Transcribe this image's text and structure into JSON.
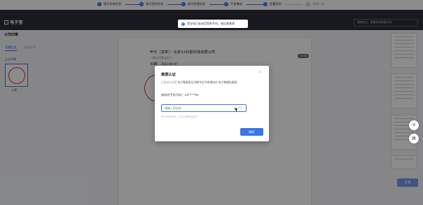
{
  "steps": [
    {
      "label": "填写机构信息",
      "state": "done"
    },
    {
      "label": "填写资质信息",
      "state": "done"
    },
    {
      "label": "填写经营信息",
      "state": "done"
    },
    {
      "label": "平台审核",
      "state": "done"
    },
    {
      "label": "签署合同",
      "state": "done"
    },
    {
      "label": "领域入驻",
      "state": "pending",
      "number": "6"
    }
  ],
  "header": {
    "logo": "电子签",
    "right_text": "我的企业：某某科技有限公司"
  },
  "toast": {
    "text": "验证码已发送至您的手机，请注意查收",
    "icon": "info-icon"
  },
  "left": {
    "section_title": "公司印章",
    "tabs": [
      "签署信息",
      "添加印章"
    ],
    "seal_group_label": "企业印章",
    "seal_name": "公章"
  },
  "document": {
    "party": "甲方（签章）：北京XX红颜科技有限公司",
    "sub": "（单位印章法定人）",
    "date": "日期：2022-09-07",
    "tag": "1/17页"
  },
  "modal": {
    "title": "意愿认证",
    "close": "×",
    "info_prefix": "已阅读并同意",
    "info_docs": "电子数据签证书数字证书申请协议  电子数据私据规",
    "phone_label": "接收的手机号码：",
    "phone_value": "137*****92",
    "input_placeholder": "请输入验证码",
    "send_label": "60s",
    "hint": "收不到验证码，试试 语音验证码",
    "ok_label": "确定"
  },
  "sign_button": "签署",
  "colors": {
    "accent": "#3a75e6",
    "header": "#2a2e37",
    "seal": "#d23"
  }
}
